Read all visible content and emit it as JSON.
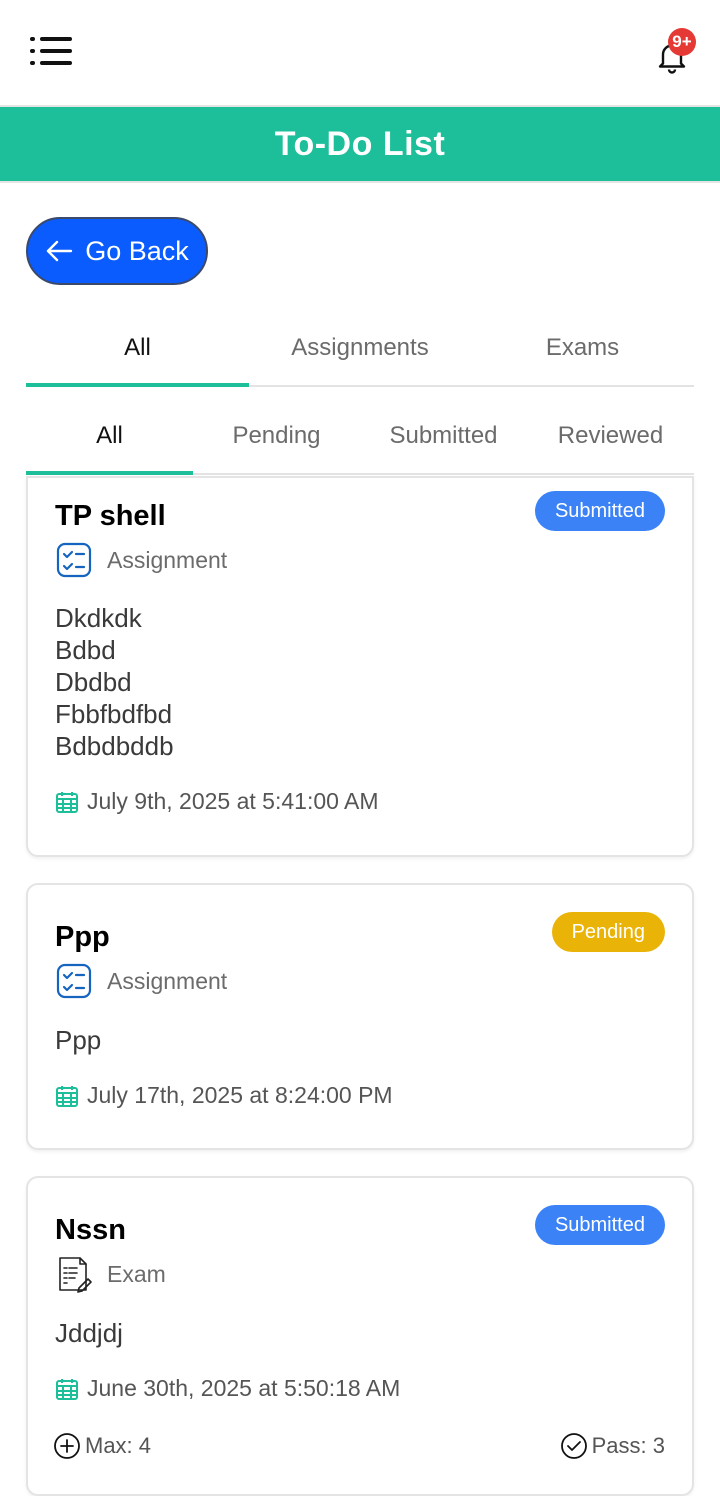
{
  "notifications": {
    "badge": "9+"
  },
  "header": {
    "title": "To-Do List"
  },
  "back_button": {
    "label": "Go Back"
  },
  "tabs_primary": [
    {
      "label": "All",
      "active": true
    },
    {
      "label": "Assignments",
      "active": false
    },
    {
      "label": "Exams",
      "active": false
    }
  ],
  "tabs_status": [
    {
      "label": "All",
      "active": true
    },
    {
      "label": "Pending",
      "active": false
    },
    {
      "label": "Submitted",
      "active": false
    },
    {
      "label": "Reviewed",
      "active": false
    }
  ],
  "colors": {
    "accent": "#1dbf9a",
    "primary_button": "#0a5cff",
    "submitted": "#3b82f6",
    "pending": "#eab308",
    "notification": "#e53935"
  },
  "cards": [
    {
      "title": "TP shell",
      "status": "Submitted",
      "type": "Assignment",
      "type_icon": "checklist-icon",
      "description": [
        "Dkdkdk",
        "Bdbd",
        "Dbdbd",
        "Fbbfbdfbd",
        "Bdbdbddb"
      ],
      "date": "July 9th, 2025 at 5:41:00 AM"
    },
    {
      "title": "Ppp",
      "status": "Pending",
      "type": "Assignment",
      "type_icon": "checklist-icon",
      "description": [
        "Ppp"
      ],
      "date": "July 17th, 2025 at 8:24:00 PM"
    },
    {
      "title": "Nssn",
      "status": "Submitted",
      "type": "Exam",
      "type_icon": "exam-sheet-icon",
      "description": [
        "Jddjdj"
      ],
      "date": "June 30th, 2025 at 5:50:18 AM",
      "max": "Max: 4",
      "pass": "Pass: 3"
    }
  ]
}
